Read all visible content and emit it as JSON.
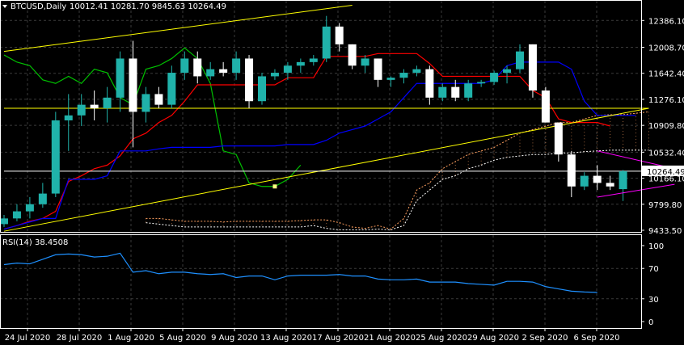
{
  "header": {
    "symbol": "BTCUSD,Daily",
    "ohlc": "10012.41 10281.70 9845.63 10264.49",
    "symbol_icon": "triangle-down-icon"
  },
  "rsi_header": "RSI(14) 38.4508",
  "colors": {
    "background": "#000000",
    "grid": "#3a3a3a",
    "frame": "#ffffff",
    "bull": "#20b2aa",
    "bear": "#ffffff",
    "tenkan": "#ff0000",
    "kijun": "#0000ff",
    "chikou": "#00c000",
    "kumo": "#ffa060",
    "chaikin_like": "#ffffff",
    "trendline": "#ffff00",
    "wedge": "#ff00ff",
    "rsi": "#1e90ff"
  },
  "chart_data": [
    {
      "type": "candlestick",
      "title": "BTCUSD,Daily",
      "price_labels": [
        "12386.10",
        "12008.70",
        "11642.40",
        "11276.10",
        "10909.80",
        "10532.40",
        "10264.49",
        "10166.10",
        "9799.80",
        "9433.50"
      ],
      "current_price": "10264.49",
      "x_labels": [
        "24 Jul 2020",
        "28 Jul 2020",
        "1 Aug 2020",
        "5 Aug 2020",
        "9 Aug 2020",
        "13 Aug 2020",
        "17 Aug 2020",
        "21 Aug 2020",
        "25 Aug 2020",
        "29 Aug 2020",
        "2 Sep 2020",
        "6 Sep 2020"
      ],
      "ylim": [
        9433.5,
        12600
      ],
      "candles": [
        {
          "o": 9520,
          "h": 9650,
          "l": 9480,
          "c": 9600
        },
        {
          "o": 9600,
          "h": 9800,
          "l": 9560,
          "c": 9700
        },
        {
          "o": 9700,
          "h": 9900,
          "l": 9600,
          "c": 9800
        },
        {
          "o": 9800,
          "h": 10100,
          "l": 9750,
          "c": 9950
        },
        {
          "o": 9950,
          "h": 11100,
          "l": 9900,
          "c": 10980
        },
        {
          "o": 10980,
          "h": 11350,
          "l": 10550,
          "c": 11050
        },
        {
          "o": 11050,
          "h": 11350,
          "l": 10900,
          "c": 11200
        },
        {
          "o": 11200,
          "h": 11400,
          "l": 10980,
          "c": 11150
        },
        {
          "o": 11150,
          "h": 11450,
          "l": 10950,
          "c": 11300
        },
        {
          "o": 11300,
          "h": 11950,
          "l": 11100,
          "c": 11850
        },
        {
          "o": 11850,
          "h": 12100,
          "l": 10600,
          "c": 11100
        },
        {
          "o": 11100,
          "h": 11450,
          "l": 10950,
          "c": 11350
        },
        {
          "o": 11350,
          "h": 11450,
          "l": 11150,
          "c": 11200
        },
        {
          "o": 11200,
          "h": 11750,
          "l": 11150,
          "c": 11650
        },
        {
          "o": 11650,
          "h": 11950,
          "l": 11550,
          "c": 11850
        },
        {
          "o": 11850,
          "h": 11950,
          "l": 11500,
          "c": 11600
        },
        {
          "o": 11600,
          "h": 11800,
          "l": 11550,
          "c": 11700
        },
        {
          "o": 11700,
          "h": 11800,
          "l": 11600,
          "c": 11650
        },
        {
          "o": 11650,
          "h": 11950,
          "l": 11550,
          "c": 11850
        },
        {
          "o": 11850,
          "h": 11900,
          "l": 11150,
          "c": 11250
        },
        {
          "o": 11250,
          "h": 11650,
          "l": 11200,
          "c": 11600
        },
        {
          "o": 11600,
          "h": 11700,
          "l": 11550,
          "c": 11650
        },
        {
          "o": 11650,
          "h": 11800,
          "l": 11550,
          "c": 11750
        },
        {
          "o": 11750,
          "h": 11850,
          "l": 11650,
          "c": 11800
        },
        {
          "o": 11800,
          "h": 11900,
          "l": 11750,
          "c": 11850
        },
        {
          "o": 11850,
          "h": 12450,
          "l": 11800,
          "c": 12300
        },
        {
          "o": 12300,
          "h": 12350,
          "l": 11950,
          "c": 12050
        },
        {
          "o": 12050,
          "h": 12050,
          "l": 11700,
          "c": 11750
        },
        {
          "o": 11750,
          "h": 11900,
          "l": 11650,
          "c": 11850
        },
        {
          "o": 11850,
          "h": 11850,
          "l": 11450,
          "c": 11550
        },
        {
          "o": 11550,
          "h": 11600,
          "l": 11450,
          "c": 11580
        },
        {
          "o": 11580,
          "h": 11700,
          "l": 11500,
          "c": 11650
        },
        {
          "o": 11650,
          "h": 11750,
          "l": 11600,
          "c": 11700
        },
        {
          "o": 11700,
          "h": 11750,
          "l": 11200,
          "c": 11300
        },
        {
          "o": 11300,
          "h": 11500,
          "l": 11250,
          "c": 11450
        },
        {
          "o": 11450,
          "h": 11550,
          "l": 11250,
          "c": 11300
        },
        {
          "o": 11300,
          "h": 11550,
          "l": 11250,
          "c": 11500
        },
        {
          "o": 11500,
          "h": 11550,
          "l": 11450,
          "c": 11520
        },
        {
          "o": 11520,
          "h": 11680,
          "l": 11480,
          "c": 11650
        },
        {
          "o": 11650,
          "h": 11750,
          "l": 11500,
          "c": 11700
        },
        {
          "o": 11700,
          "h": 12050,
          "l": 11650,
          "c": 11950
        },
        {
          "o": 12050,
          "h": 12050,
          "l": 11300,
          "c": 11400
        },
        {
          "o": 11400,
          "h": 11450,
          "l": 10950,
          "c": 10950
        },
        {
          "o": 10950,
          "h": 10850,
          "l": 10400,
          "c": 10500
        },
        {
          "o": 10500,
          "h": 10550,
          "l": 9900,
          "c": 10050
        },
        {
          "o": 10050,
          "h": 10250,
          "l": 10000,
          "c": 10200
        },
        {
          "o": 10200,
          "h": 10350,
          "l": 10000,
          "c": 10100
        },
        {
          "o": 10100,
          "h": 10200,
          "l": 10000,
          "c": 10050
        },
        {
          "o": 10012.41,
          "h": 10281.7,
          "l": 9845.63,
          "c": 10264.49
        }
      ],
      "tenkan": [
        9450,
        9500,
        9560,
        9600,
        9700,
        10120,
        10200,
        10300,
        10350,
        10480,
        10720,
        10800,
        10950,
        11050,
        11250,
        11480,
        11480,
        11480,
        11480,
        11480,
        11480,
        11480,
        11580,
        11580,
        11580,
        11880,
        11880,
        11880,
        11880,
        11920,
        11920,
        11920,
        11920,
        11780,
        11600,
        11600,
        11600,
        11600,
        11600,
        11600,
        11600,
        11400,
        11300,
        11000,
        10950,
        10950,
        10950,
        10900
      ],
      "kijun": [
        9450,
        9500,
        9550,
        9600,
        9600,
        10150,
        10150,
        10150,
        10200,
        10550,
        10550,
        10550,
        10580,
        10600,
        10600,
        10600,
        10600,
        10620,
        10620,
        10620,
        10620,
        10620,
        10640,
        10640,
        10640,
        10700,
        10800,
        10850,
        10900,
        11000,
        11100,
        11300,
        11500,
        11500,
        11500,
        11500,
        11500,
        11500,
        11550,
        11750,
        11800,
        11800,
        11800,
        11800,
        11700,
        11250,
        11050,
        11050,
        11050,
        11050
      ],
      "chikou": [
        11900,
        11800,
        11750,
        11550,
        11500,
        11600,
        11500,
        11700,
        11650,
        11300,
        11200,
        11700,
        11750,
        11850,
        12000,
        11850,
        11500,
        10550,
        10500,
        10100,
        10050,
        10050,
        10150,
        10350
      ],
      "kumo_upper": [
        9600,
        9600,
        9580,
        9560,
        9560,
        9560,
        9550,
        9560,
        9560,
        9560,
        9560,
        9560,
        9570,
        9580,
        9580,
        9540,
        9480,
        9460,
        9500,
        9450,
        9600,
        10000,
        10100,
        10300,
        10400,
        10500,
        10550,
        10600,
        10700,
        10800,
        10850,
        10900,
        10950,
        10950,
        11000,
        11050,
        11060,
        11060,
        11080,
        11100
      ],
      "kumo_lower": [
        9540,
        9520,
        9500,
        9480,
        9480,
        9480,
        9480,
        9480,
        9480,
        9480,
        9480,
        9480,
        9480,
        9500,
        9460,
        9440,
        9440,
        9440,
        9450,
        9440,
        9500,
        9850,
        10000,
        10150,
        10200,
        10300,
        10350,
        10420,
        10460,
        10480,
        10500,
        10500,
        10520,
        10520,
        10540,
        10550,
        10560,
        10560,
        10560,
        10560
      ],
      "trendlines": [
        {
          "name": "upper-channel",
          "p1": {
            "i": 0,
            "v": 11950
          },
          "p2": {
            "i": 27,
            "v": 12600
          }
        },
        {
          "name": "lower-channel",
          "p1": {
            "i": 0,
            "v": 9420
          },
          "p2": {
            "i": 50,
            "v": 11150
          }
        },
        {
          "name": "horizontal-support",
          "p1": {
            "i": 0,
            "v": 11150
          },
          "p2": {
            "i": 50,
            "v": 11150
          }
        },
        {
          "name": "current-price",
          "p1": {
            "i": 0,
            "v": 10264.49
          },
          "p2": {
            "i": 50,
            "v": 10264.49
          }
        }
      ],
      "wedge": [
        {
          "p1": {
            "i": 46,
            "v": 10550
          },
          "p2": {
            "i": 52,
            "v": 10300
          }
        },
        {
          "p1": {
            "i": 46,
            "v": 9900
          },
          "p2": {
            "i": 52,
            "v": 10080
          }
        }
      ],
      "annotation_point": {
        "i": 21,
        "v": 10050
      }
    },
    {
      "type": "line",
      "title": "RSI(14) 38.4508",
      "y_labels": [
        "100",
        "70",
        "30",
        "0"
      ],
      "ylim": [
        0,
        100
      ],
      "values": [
        75,
        77,
        76,
        82,
        88,
        89,
        88,
        85,
        86,
        90,
        65,
        67,
        63,
        65,
        65,
        63,
        62,
        63,
        58,
        60,
        60,
        55,
        60,
        61,
        61,
        61,
        62,
        60,
        60,
        56,
        55,
        55,
        56,
        52,
        52,
        52,
        50,
        49,
        48,
        53,
        53,
        52,
        46,
        43,
        40,
        39,
        38.4508
      ]
    }
  ]
}
